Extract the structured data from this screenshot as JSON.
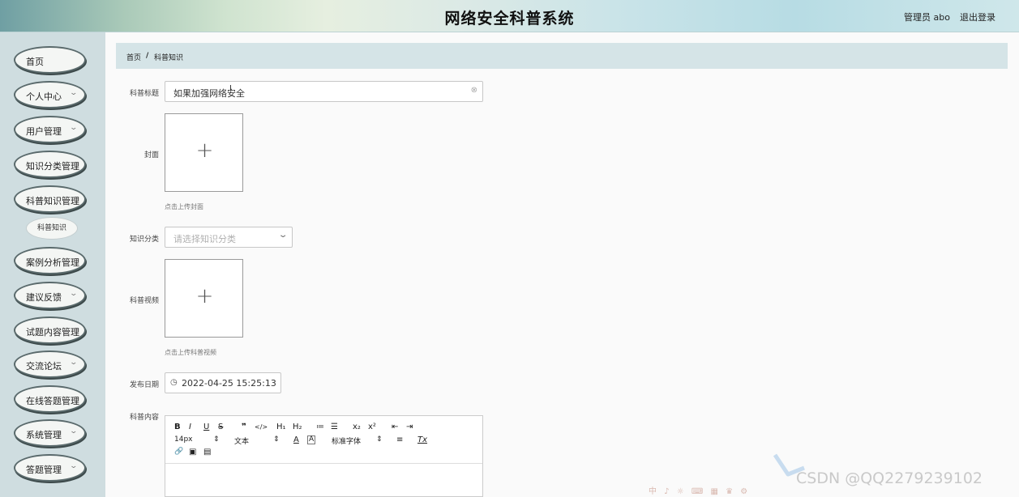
{
  "header": {
    "title": "网络安全科普系统",
    "user": "管理员 abo",
    "logout": "退出登录"
  },
  "sidebar": {
    "items": [
      {
        "label": "首页",
        "chevron": false
      },
      {
        "label": "个人中心",
        "chevron": true
      },
      {
        "label": "用户管理",
        "chevron": true
      },
      {
        "label": "知识分类管理",
        "chevron": false
      },
      {
        "label": "科普知识管理",
        "chevron": false
      },
      {
        "label": "案例分析管理",
        "chevron": false
      },
      {
        "label": "建议反馈",
        "chevron": true
      },
      {
        "label": "试题内容管理",
        "chevron": false
      },
      {
        "label": "交流论坛",
        "chevron": true
      },
      {
        "label": "在线答题管理",
        "chevron": false
      },
      {
        "label": "系统管理",
        "chevron": true
      },
      {
        "label": "答题管理",
        "chevron": true
      }
    ],
    "sub_item": "科普知识",
    "chevron_glyph": "⌄"
  },
  "breadcrumb": {
    "home": "首页",
    "sep": "/",
    "current": "科普知识"
  },
  "form": {
    "title_label": "科普标题",
    "title_value": "如果加强网络安全",
    "clear_icon": "⊗",
    "cover_label": "封面",
    "cover_hint": "点击上传封面",
    "category_label": "知识分类",
    "category_placeholder": "请选择知识分类",
    "video_label": "科普视频",
    "video_hint": "点击上传科普视频",
    "date_label": "发布日期",
    "date_value": "2022-04-25 15:25:13",
    "content_label": "科普内容",
    "plus": "+"
  },
  "editor": {
    "row1": [
      "B",
      "I",
      "U",
      "S",
      "❞",
      "</>",
      "H₁",
      "H₂",
      "≔",
      "☰",
      "x₂",
      "x²",
      "⇤",
      "⇥"
    ],
    "font_size": "14px",
    "text_type": "文本",
    "font_family": "标准字体",
    "updown": "⇕",
    "color_a": "A",
    "bg_a": "A",
    "align": "≡",
    "clear_format": "Tx",
    "row3": [
      "🔗",
      "▣",
      "▤"
    ]
  },
  "watermark": "CSDN @QQ2279239102",
  "mini_toolbar": "中 ♪ ☼ ⌨ ▦ ♛ ⚙"
}
